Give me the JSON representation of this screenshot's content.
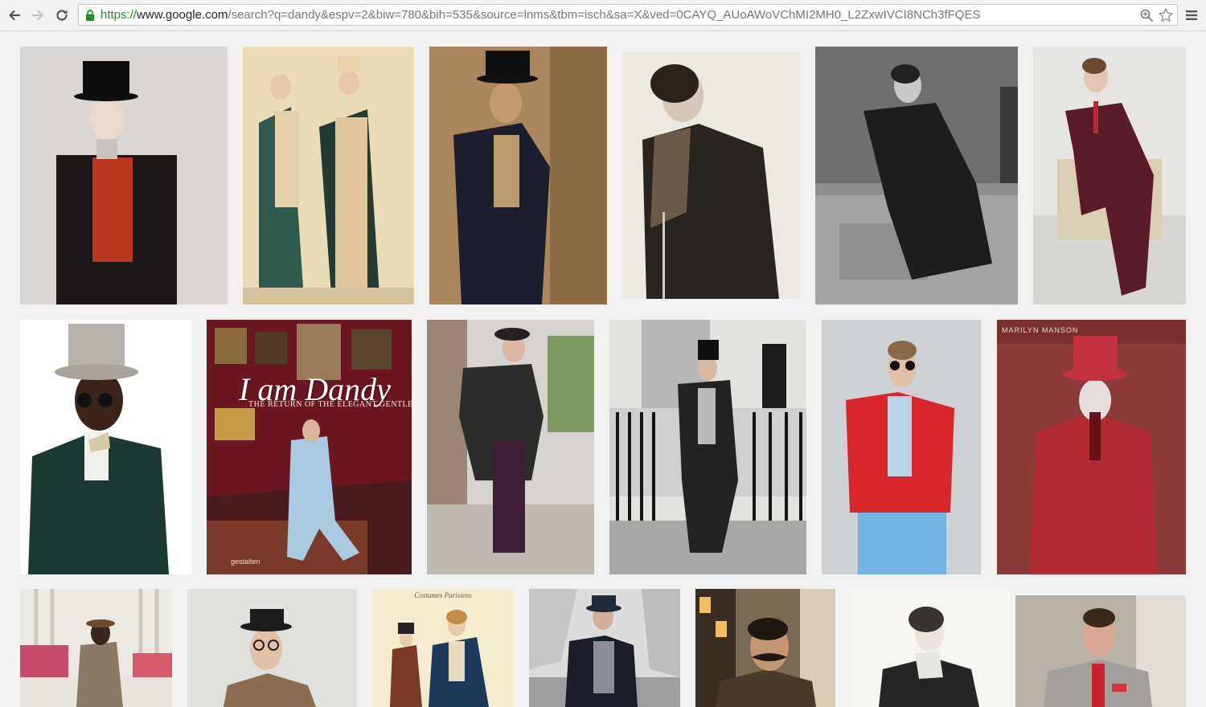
{
  "browser": {
    "url_scheme": "https://",
    "url_host": "www.google.com",
    "url_path": "/search?q=dandy&espv=2&biw=780&bih=535&source=lnms&tbm=isch&sa=X&ved=0CAYQ_AUoAWoVChMI2MH0_L2ZxwIVCI8NCh3fFQES"
  },
  "images": {
    "dandy_book_title": "I am Dandy",
    "dandy_book_subtitle": "THE RETURN OF THE ELEGANT GENTLEMAN",
    "dandy_book_publisher": "gestalten",
    "manson_header": "MARILYN MANSON",
    "fashion_plate_header": "Costumes Parisiens"
  },
  "colors": {
    "secure_green": "#1a9a1a",
    "page_bg": "#f1f1f1"
  }
}
